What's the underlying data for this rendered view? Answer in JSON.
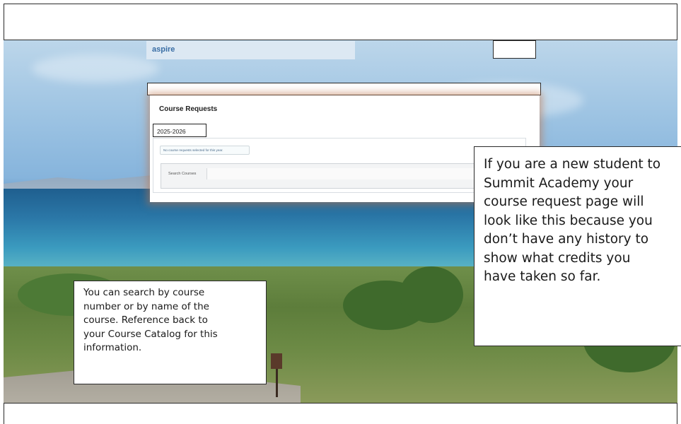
{
  "app": {
    "brand": "aspire"
  },
  "panel": {
    "title": "Course Requests",
    "year_tab": "2025-2026",
    "no_requests_msg": "No course requests selected for this year.",
    "search_label": "Search Courses",
    "search_value": ""
  },
  "callouts": {
    "right_lines": [
      "If you are a new student to",
      "Summit Academy your",
      "course request page will",
      "look like this because you",
      "don’t have any history to",
      "show what credits you",
      "have taken so far."
    ],
    "left_lines": [
      "You can search by course",
      "number or by name of the",
      "course.  Reference back to",
      "your Course Catalog for this",
      "information."
    ]
  },
  "colors": {
    "brand_text": "#3a6ea5",
    "brand_strip": "#dce8f3",
    "panel_glow": "#be7850"
  }
}
